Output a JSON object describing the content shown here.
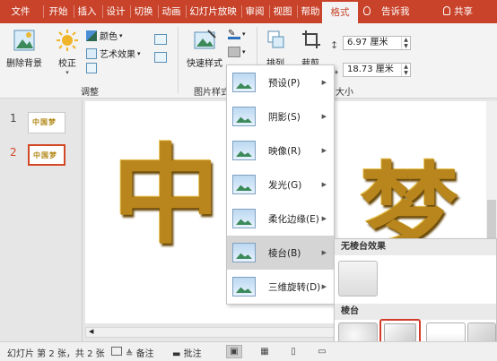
{
  "ribbon_tabs": [
    "文件",
    "开始",
    "插入",
    "设计",
    "切换",
    "动画",
    "幻灯片放映",
    "审阅",
    "视图",
    "帮助",
    "格式"
  ],
  "tell_me": "告诉我",
  "share": "共享",
  "ribbon": {
    "remove_bg": "删除背景",
    "corrections": "校正",
    "color": "颜色",
    "artistic_effects": "艺术效果",
    "adjust_group": "调整",
    "quick_styles": "快速样式",
    "picture_styles_group": "图片样式",
    "arrange": "排列",
    "crop": "裁剪",
    "size_group": "大小",
    "height": "6.97 厘米",
    "width": "18.73 厘米"
  },
  "slides": [
    {
      "number": "1",
      "thumb_text": "中国梦"
    },
    {
      "number": "2",
      "thumb_text": "中国梦"
    }
  ],
  "slide_text": {
    "char1": "中",
    "char2": "梦"
  },
  "effects_menu": {
    "items": [
      "预设(P)",
      "阴影(S)",
      "映像(R)",
      "发光(G)",
      "柔化边缘(E)",
      "棱台(B)",
      "三维旋转(D)"
    ],
    "highlighted": "棱台(B)"
  },
  "bevel_gallery": {
    "no_bevel_header": "无棱台效果",
    "bevel_header": "棱台"
  },
  "status_bar": {
    "slide_info": "幻灯片 第 2 张，共 2 张",
    "notes": "备注",
    "comments": "批注"
  },
  "colors": {
    "accent": "#c9432b",
    "selected_border": "#d24726",
    "gold": "#b08512"
  }
}
